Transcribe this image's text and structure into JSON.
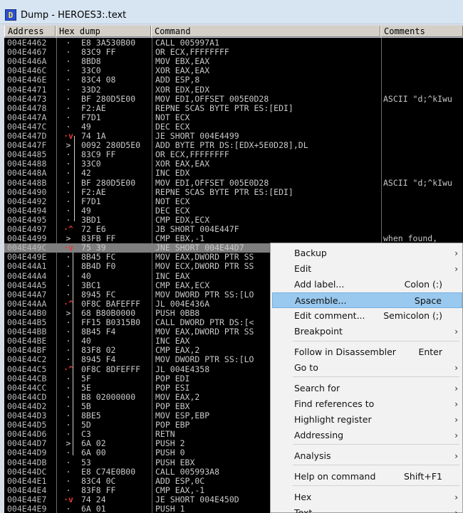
{
  "window": {
    "icon_letter": "D",
    "title": "Dump - HEROES3:.text"
  },
  "columns": [
    "Address",
    "Hex dump",
    "Command",
    "Comments"
  ],
  "rows": [
    [
      "004E4462",
      "·",
      "E8 3A530B00",
      "CALL 005997A1",
      ""
    ],
    [
      "004E4467",
      "·",
      "83C9 FF",
      "OR ECX,FFFFFFFF",
      ""
    ],
    [
      "004E446A",
      "·",
      "8BD8",
      "MOV EBX,EAX",
      ""
    ],
    [
      "004E446C",
      "·",
      "33C0",
      "XOR EAX,EAX",
      ""
    ],
    [
      "004E446E",
      "·",
      "83C4 08",
      "ADD ESP,8",
      ""
    ],
    [
      "004E4471",
      "·",
      "33D2",
      "XOR EDX,EDX",
      ""
    ],
    [
      "004E4473",
      "·",
      "BF 280D5E00",
      "MOV EDI,OFFSET 005E0D28",
      "ASCII \"d;^kIwu"
    ],
    [
      "004E4478",
      "·",
      "F2:AE",
      "REPNE SCAS BYTE PTR ES:[EDI]",
      ""
    ],
    [
      "004E447A",
      "·",
      "F7D1",
      "NOT ECX",
      ""
    ],
    [
      "004E447C",
      "·",
      "49",
      "DEC ECX",
      ""
    ],
    [
      "004E447D",
      "·v",
      "74 1A",
      "JE SHORT 004E4499",
      ""
    ],
    [
      "004E447F",
      ">",
      "0092 280D5E0",
      "ADD BYTE PTR DS:[EDX+5E0D28],DL",
      ""
    ],
    [
      "004E4485",
      "·",
      "83C9 FF",
      "OR ECX,FFFFFFFF",
      ""
    ],
    [
      "004E4488",
      "·",
      "33C0",
      "XOR EAX,EAX",
      ""
    ],
    [
      "004E448A",
      "·",
      "42",
      "INC EDX",
      ""
    ],
    [
      "004E448B",
      "·",
      "BF 280D5E00",
      "MOV EDI,OFFSET 005E0D28",
      "ASCII \"d;^kIwu"
    ],
    [
      "004E4490",
      "·",
      "F2:AE",
      "REPNE SCAS BYTE PTR ES:[EDI]",
      ""
    ],
    [
      "004E4492",
      "·",
      "F7D1",
      "NOT ECX",
      ""
    ],
    [
      "004E4494",
      "·",
      "49",
      "DEC ECX",
      ""
    ],
    [
      "004E4495",
      "·",
      "3BD1",
      "CMP EDX,ECX",
      ""
    ],
    [
      "004E4497",
      "·^",
      "72 E6",
      "JB SHORT 004E447F",
      ""
    ],
    [
      "004E4499",
      ">",
      "83FB FF",
      "CMP EBX,-1",
      "when found,"
    ],
    [
      "004E449C",
      "·v",
      "75 39",
      "JNE SHORT 004E44D7",
      ""
    ],
    [
      "004E449E",
      "·",
      "8B45 FC",
      "MOV EAX,DWORD PTR SS",
      ""
    ],
    [
      "004E44A1",
      "·",
      "8B4D F0",
      "MOV ECX,DWORD PTR SS",
      ""
    ],
    [
      "004E44A4",
      "·",
      "40",
      "INC EAX",
      ""
    ],
    [
      "004E44A5",
      "·",
      "3BC1",
      "CMP EAX,ECX",
      ""
    ],
    [
      "004E44A7",
      "·",
      "8945 FC",
      "MOV DWORD PTR SS:[LO",
      ""
    ],
    [
      "004E44AA",
      "·^",
      "0F8C BAFEFFF",
      "JL 004E436A",
      ""
    ],
    [
      "004E44B0",
      ">",
      "68 B80B0000",
      "PUSH 0BB8",
      ""
    ],
    [
      "004E44B5",
      "·",
      "FF15 B0315B0",
      "CALL DWORD PTR DS:[<",
      ""
    ],
    [
      "004E44BB",
      "·",
      "8B45 F4",
      "MOV EAX,DWORD PTR SS",
      ""
    ],
    [
      "004E44BE",
      "·",
      "40",
      "INC EAX",
      ""
    ],
    [
      "004E44BF",
      "·",
      "83F8 02",
      "CMP EAX,2",
      ""
    ],
    [
      "004E44C2",
      "·",
      "8945 F4",
      "MOV DWORD PTR SS:[LO",
      ""
    ],
    [
      "004E44C5",
      "·^",
      "0F8C 8DFEFFF",
      "JL 004E4358",
      ""
    ],
    [
      "004E44CB",
      "·",
      "5F",
      "POP EDI",
      ""
    ],
    [
      "004E44CC",
      "·",
      "5E",
      "POP ESI",
      ""
    ],
    [
      "004E44CD",
      "·",
      "B8 02000000",
      "MOV EAX,2",
      ""
    ],
    [
      "004E44D2",
      "·",
      "5B",
      "POP EBX",
      ""
    ],
    [
      "004E44D3",
      "·",
      "8BE5",
      "MOV ESP,EBP",
      ""
    ],
    [
      "004E44D5",
      "·",
      "5D",
      "POP EBP",
      ""
    ],
    [
      "004E44D6",
      "·",
      "C3",
      "RETN",
      ""
    ],
    [
      "004E44D7",
      ">",
      "6A 02",
      "PUSH 2",
      ""
    ],
    [
      "004E44D9",
      "·",
      "6A 00",
      "PUSH 0",
      ""
    ],
    [
      "004E44DB",
      "·",
      "53",
      "PUSH EBX",
      ""
    ],
    [
      "004E44DC",
      "·",
      "E8 C74E0B00",
      "CALL 005993A8",
      ""
    ],
    [
      "004E44E1",
      "·",
      "83C4 0C",
      "ADD ESP,0C",
      ""
    ],
    [
      "004E44E4",
      "·",
      "83F8 FF",
      "CMP EAX,-1",
      ""
    ],
    [
      "004E44E7",
      "·v",
      "74 24",
      "JE SHORT 004E450D",
      ""
    ],
    [
      "004E44E9",
      "·",
      "6A 01",
      "PUSH 1",
      ""
    ],
    [
      "004E44EB",
      "·",
      "6A 00",
      "PUSH 64",
      ""
    ]
  ],
  "selected_row": 22,
  "context_menu": {
    "items": [
      {
        "label": "Backup",
        "shortcut": "",
        "arrow": "›"
      },
      {
        "label": "Edit",
        "shortcut": "",
        "arrow": "›"
      },
      {
        "label": "Add label...",
        "shortcut": "Colon (:)",
        "arrow": ""
      },
      {
        "label": "Assemble...",
        "shortcut": "Space",
        "arrow": "",
        "highlighted": true
      },
      {
        "label": "Edit comment...",
        "shortcut": "Semicolon (;)",
        "arrow": ""
      },
      {
        "label": "Breakpoint",
        "shortcut": "",
        "arrow": "›"
      },
      {
        "label": "Follow in Disassembler",
        "shortcut": "Enter",
        "arrow": ""
      },
      {
        "label": "Go to",
        "shortcut": "",
        "arrow": "›"
      },
      {
        "label": "Search for",
        "shortcut": "",
        "arrow": "›"
      },
      {
        "label": "Find references to",
        "shortcut": "",
        "arrow": "›"
      },
      {
        "label": "Highlight register",
        "shortcut": "",
        "arrow": "›"
      },
      {
        "label": "Addressing",
        "shortcut": "",
        "arrow": "›"
      },
      {
        "label": "Analysis",
        "shortcut": "",
        "arrow": "›"
      },
      {
        "label": "Help on command",
        "shortcut": "Shift+F1",
        "arrow": ""
      },
      {
        "label": "Hex",
        "shortcut": "",
        "arrow": "›"
      },
      {
        "label": "Text",
        "shortcut": "",
        "arrow": "›"
      }
    ]
  },
  "colors": {
    "listing_bg": "#000000",
    "selected_row": "#7f7f7f",
    "menu_highlight": "#99c9ef",
    "jump_marker": "#e03c3c"
  }
}
